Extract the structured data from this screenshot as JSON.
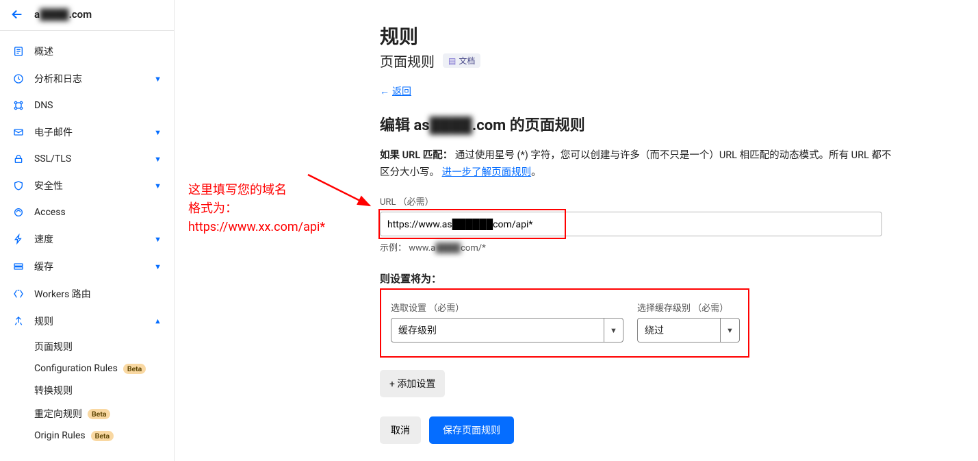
{
  "header": {
    "domain_obscured": "a████.com"
  },
  "sidebar": {
    "items": [
      {
        "id": "overview",
        "label": "概述",
        "expandable": false
      },
      {
        "id": "analytics",
        "label": "分析和日志",
        "expandable": true
      },
      {
        "id": "dns",
        "label": "DNS",
        "expandable": false
      },
      {
        "id": "email",
        "label": "电子邮件",
        "expandable": true
      },
      {
        "id": "ssl",
        "label": "SSL/TLS",
        "expandable": true
      },
      {
        "id": "security",
        "label": "安全性",
        "expandable": true
      },
      {
        "id": "access",
        "label": "Access",
        "expandable": false
      },
      {
        "id": "speed",
        "label": "速度",
        "expandable": true
      },
      {
        "id": "cache",
        "label": "缓存",
        "expandable": true
      },
      {
        "id": "workers",
        "label": "Workers 路由",
        "expandable": false
      },
      {
        "id": "rules",
        "label": "规则",
        "expandable": true,
        "expanded": true
      }
    ],
    "subrules": [
      {
        "label": "页面规则",
        "beta": false
      },
      {
        "label": "Configuration Rules",
        "beta": true
      },
      {
        "label": "转换规则",
        "beta": false
      },
      {
        "label": "重定向规则",
        "beta": true
      },
      {
        "label": "Origin Rules",
        "beta": true
      }
    ],
    "beta_text": "Beta"
  },
  "main": {
    "title": "规则",
    "subtitle": "页面规则",
    "doc_tag": "文档",
    "back": "返回",
    "edit_prefix": "编辑 as",
    "edit_suffix": ".com 的页面规则",
    "match_label": "如果 URL 匹配：",
    "match_text": "通过使用星号 (*) 字符，您可以创建与许多（而不只是一个）URL 相匹配的动态模式。所有 URL 都不区分大小写。",
    "learn_more": "进一步了解页面规则",
    "period": "。",
    "url_label": "URL （必需）",
    "url_value": "https://www.as██████com/api*",
    "example_prefix": "示例：   www.a",
    "example_suffix": "com/*",
    "then_label": "则设置将为：",
    "select_label": "选取设置 （必需）",
    "select_value": "缓存级别",
    "cache_label": "选择缓存级别 （必需）",
    "cache_value": "绕过",
    "add_setting": "+ 添加设置",
    "cancel": "取消",
    "save": "保存页面规则"
  },
  "annotation": {
    "line1": "这里填写您的域名",
    "line2": "格式为：",
    "line3": "https://www.xx.com/api*"
  }
}
